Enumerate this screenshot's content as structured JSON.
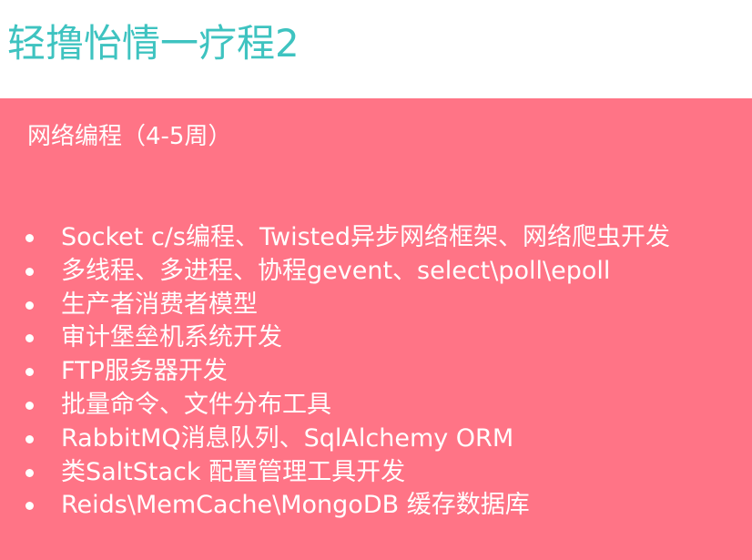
{
  "slide": {
    "title": "轻撸怡情一疗程2",
    "subtitle": "网络编程（4-5周）",
    "bullets": [
      "Socket c/s编程、Twisted异步网络框架、网络爬虫开发",
      "多线程、多进程、协程gevent、select\\poll\\epoll",
      "生产者消费者模型",
      "审计堡垒机系统开发",
      "FTP服务器开发",
      "批量命令、文件分布工具",
      "RabbitMQ消息队列、SqlAlchemy ORM",
      "类SaltStack 配置管理工具开发",
      "Reids\\MemCache\\MongoDB 缓存数据库"
    ]
  },
  "colors": {
    "title": "#3ec3c0",
    "panel": "#ff7486",
    "text": "#ffffff"
  }
}
